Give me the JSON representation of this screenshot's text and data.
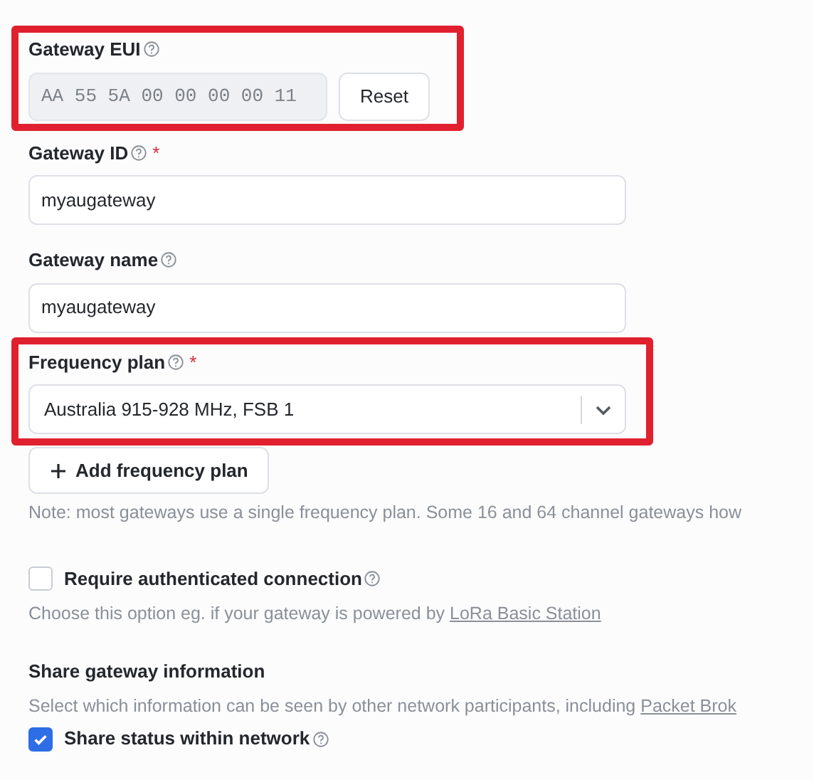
{
  "gateway_eui": {
    "label": "Gateway EUI",
    "value": "AA 55 5A 00 00 00 00 11",
    "button": "Reset",
    "highlighted": true
  },
  "gateway_id": {
    "label": "Gateway ID",
    "required_mark": "*",
    "value": "myaugateway"
  },
  "gateway_name": {
    "label": "Gateway name",
    "value": "myaugateway"
  },
  "frequency_plan": {
    "label": "Frequency plan",
    "required_mark": "*",
    "value": "Australia 915-928 MHz, FSB 1",
    "highlighted": true,
    "add_button": "Add frequency plan",
    "note": "Note: most gateways use a single frequency plan. Some 16 and 64 channel gateways how"
  },
  "authenticated": {
    "label": "Require authenticated connection",
    "checked": false,
    "description": "Choose this option eg. if your gateway is powered by ",
    "link": "LoRa Basic Station"
  },
  "share": {
    "heading": "Share gateway information",
    "description": "Select which information can be seen by other network participants, including ",
    "link": "Packet Brok",
    "option": {
      "label": "Share status within network",
      "checked": true
    }
  }
}
